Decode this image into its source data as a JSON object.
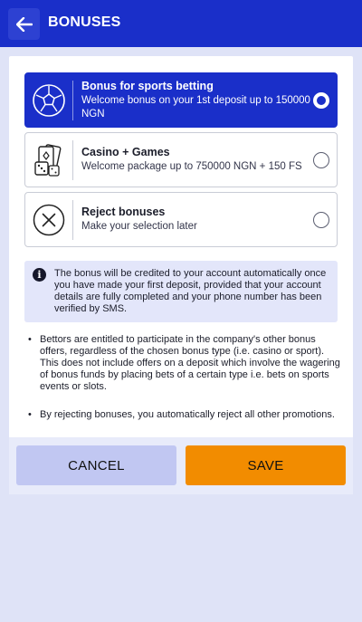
{
  "header": {
    "title": "BONUSES",
    "back_icon": "arrow-left-icon"
  },
  "options": [
    {
      "title": "Bonus for sports betting",
      "subtitle": "Welcome bonus on your 1st deposit up to 150000 NGN",
      "icon": "soccer-ball-icon",
      "selected": true
    },
    {
      "title": "Casino + Games",
      "subtitle": "Welcome package up to 750000 NGN + 150 FS",
      "icon": "cards-dice-icon",
      "selected": false
    },
    {
      "title": "Reject bonuses",
      "subtitle": "Make your selection later",
      "icon": "reject-x-icon",
      "selected": false
    }
  ],
  "info": {
    "text": "The bonus will be credited to your account automatically once you have made your first deposit, provided that your account details are fully completed and your phone number has been verified by SMS."
  },
  "notes": [
    "Bettors are entitled to participate in the company's other bonus offers, regardless of the chosen bonus type (i.e. casino or sport). This does not include offers on a deposit which involve the wagering of bonus funds by placing bets of a certain type i.e. bets on sports events or slots.",
    "By rejecting bonuses, you automatically reject all other promotions."
  ],
  "bullet": "•",
  "buttons": {
    "cancel_label": "CANCEL",
    "save_label": "SAVE"
  },
  "colors": {
    "accent": "#1a2fc9",
    "save": "#f28c00",
    "cancel": "#c1c7f2"
  }
}
